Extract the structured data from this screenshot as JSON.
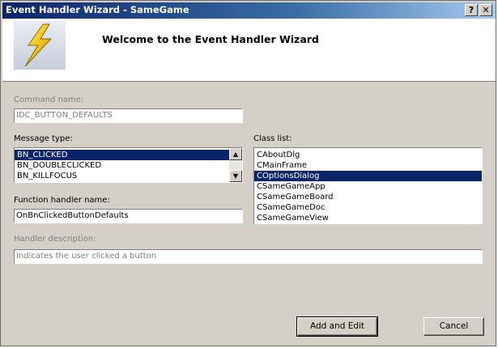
{
  "window": {
    "title": "Event Handler Wizard - SameGame",
    "help_label": "?",
    "close_label": "✕"
  },
  "header": {
    "title": "Welcome to the Event Handler Wizard",
    "logo_icon": "lightning-bolt-icon"
  },
  "command": {
    "label": "Command name:",
    "value": "IDC_BUTTON_DEFAULTS"
  },
  "message_type": {
    "label": "Message type:",
    "items": [
      "BN_CLICKED",
      "BN_DOUBLECLICKED",
      "BN_KILLFOCUS"
    ],
    "selected": 0,
    "scroll_up": "▲",
    "scroll_down": "▼"
  },
  "class_list": {
    "label": "Class list:",
    "items": [
      "CAboutDlg",
      "CMainFrame",
      "COptionsDialog",
      "CSameGameApp",
      "CSameGameBoard",
      "CSameGameDoc",
      "CSameGameView"
    ],
    "selected": 2
  },
  "function_handler": {
    "label": "Function handler name:",
    "value": "OnBnClickedButtonDefaults"
  },
  "handler_description": {
    "label": "Handler description:",
    "value": "Indicates the user clicked a button"
  },
  "buttons": {
    "add_edit": "Add and Edit",
    "cancel": "Cancel"
  },
  "colors": {
    "selection": "#0a246a",
    "titlebar_start": "#0a246a",
    "face": "#d4d0c8"
  }
}
